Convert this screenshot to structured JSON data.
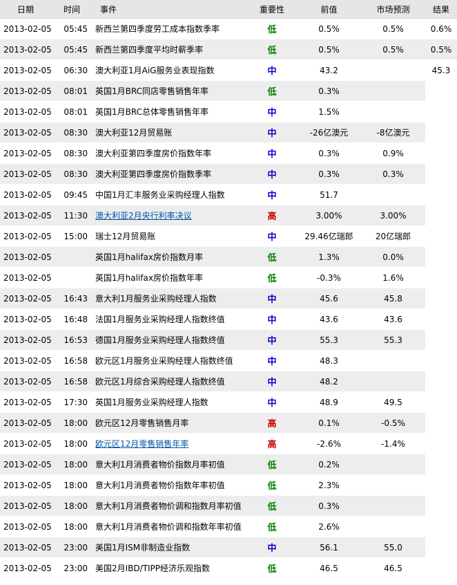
{
  "headers": {
    "date": "日期",
    "time": "时间",
    "event": "事件",
    "importance": "重要性",
    "previous": "前值",
    "forecast": "市场预测",
    "result": "结果"
  },
  "importance_colors": {
    "低": "#008000",
    "中": "#0000cc",
    "高": "#cc0000"
  },
  "rows": [
    {
      "date": "2013-02-05",
      "time": "05:45",
      "event": "新西兰第四季度劳工成本指数季率",
      "importance": "低",
      "previous": "0.5%",
      "forecast": "0.5%",
      "result": "0.6%",
      "link": false
    },
    {
      "date": "2013-02-05",
      "time": "05:45",
      "event": "新西兰第四季度平均时薪季率",
      "importance": "低",
      "previous": "0.5%",
      "forecast": "0.5%",
      "result": "0.5%",
      "link": false
    },
    {
      "date": "2013-02-05",
      "time": "06:30",
      "event": "澳大利亚1月AiG服务业表现指数",
      "importance": "中",
      "previous": "43.2",
      "forecast": "",
      "result": "45.3",
      "link": false
    },
    {
      "date": "2013-02-05",
      "time": "08:01",
      "event": "英国1月BRC同店零售销售年率",
      "importance": "低",
      "previous": "0.3%",
      "forecast": "",
      "result": "",
      "link": false
    },
    {
      "date": "2013-02-05",
      "time": "08:01",
      "event": "英国1月BRC总体零售销售年率",
      "importance": "中",
      "previous": "1.5%",
      "forecast": "",
      "result": "",
      "link": false
    },
    {
      "date": "2013-02-05",
      "time": "08:30",
      "event": "澳大利亚12月贸易账",
      "importance": "中",
      "previous": "-26亿澳元",
      "forecast": "-8亿澳元",
      "result": "",
      "link": false
    },
    {
      "date": "2013-02-05",
      "time": "08:30",
      "event": "澳大利亚第四季度房价指数年率",
      "importance": "中",
      "previous": "0.3%",
      "forecast": "0.9%",
      "result": "",
      "link": false
    },
    {
      "date": "2013-02-05",
      "time": "08:30",
      "event": "澳大利亚第四季度房价指数季率",
      "importance": "中",
      "previous": "0.3%",
      "forecast": "0.3%",
      "result": "",
      "link": false
    },
    {
      "date": "2013-02-05",
      "time": "09:45",
      "event": "中国1月汇丰服务业采购经理人指数",
      "importance": "中",
      "previous": "51.7",
      "forecast": "",
      "result": "",
      "link": false
    },
    {
      "date": "2013-02-05",
      "time": "11:30",
      "event": "澳大利亚2月央行利率决议",
      "importance": "高",
      "previous": "3.00%",
      "forecast": "3.00%",
      "result": "",
      "link": true
    },
    {
      "date": "2013-02-05",
      "time": "15:00",
      "event": "瑞士12月贸易账",
      "importance": "中",
      "previous": "29.46亿瑞郎",
      "forecast": "20亿瑞郎",
      "result": "",
      "link": false
    },
    {
      "date": "2013-02-05",
      "time": "",
      "event": "英国1月halifax房价指数月率",
      "importance": "低",
      "previous": "1.3%",
      "forecast": "0.0%",
      "result": "",
      "link": false
    },
    {
      "date": "2013-02-05",
      "time": "",
      "event": "英国1月halifax房价指数年率",
      "importance": "低",
      "previous": "-0.3%",
      "forecast": "1.6%",
      "result": "",
      "link": false
    },
    {
      "date": "2013-02-05",
      "time": "16:43",
      "event": "意大利1月服务业采购经理人指数",
      "importance": "中",
      "previous": "45.6",
      "forecast": "45.8",
      "result": "",
      "link": false
    },
    {
      "date": "2013-02-05",
      "time": "16:48",
      "event": "法国1月服务业采购经理人指数终值",
      "importance": "中",
      "previous": "43.6",
      "forecast": "43.6",
      "result": "",
      "link": false
    },
    {
      "date": "2013-02-05",
      "time": "16:53",
      "event": "德国1月服务业采购经理人指数终值",
      "importance": "中",
      "previous": "55.3",
      "forecast": "55.3",
      "result": "",
      "link": false
    },
    {
      "date": "2013-02-05",
      "time": "16:58",
      "event": "欧元区1月服务业采购经理人指数终值",
      "importance": "中",
      "previous": "48.3",
      "forecast": "",
      "result": "",
      "link": false
    },
    {
      "date": "2013-02-05",
      "time": "16:58",
      "event": "欧元区1月综合采购经理人指数终值",
      "importance": "中",
      "previous": "48.2",
      "forecast": "",
      "result": "",
      "link": false
    },
    {
      "date": "2013-02-05",
      "time": "17:30",
      "event": "英国1月服务业采购经理人指数",
      "importance": "中",
      "previous": "48.9",
      "forecast": "49.5",
      "result": "",
      "link": false
    },
    {
      "date": "2013-02-05",
      "time": "18:00",
      "event": "欧元区12月零售销售月率",
      "importance": "高",
      "previous": "0.1%",
      "forecast": "-0.5%",
      "result": "",
      "link": false
    },
    {
      "date": "2013-02-05",
      "time": "18:00",
      "event": "欧元区12月零售销售年率",
      "importance": "高",
      "previous": "-2.6%",
      "forecast": "-1.4%",
      "result": "",
      "link": true
    },
    {
      "date": "2013-02-05",
      "time": "18:00",
      "event": "意大利1月消费者物价指数月率初值",
      "importance": "低",
      "previous": "0.2%",
      "forecast": "",
      "result": "",
      "link": false
    },
    {
      "date": "2013-02-05",
      "time": "18:00",
      "event": "意大利1月消费者物价指数年率初值",
      "importance": "低",
      "previous": "2.3%",
      "forecast": "",
      "result": "",
      "link": false
    },
    {
      "date": "2013-02-05",
      "time": "18:00",
      "event": "意大利1月消费者物价调和指数月率初值",
      "importance": "低",
      "previous": "0.3%",
      "forecast": "",
      "result": "",
      "link": false
    },
    {
      "date": "2013-02-05",
      "time": "18:00",
      "event": "意大利1月消费者物价调和指数年率初值",
      "importance": "低",
      "previous": "2.6%",
      "forecast": "",
      "result": "",
      "link": false
    },
    {
      "date": "2013-02-05",
      "time": "23:00",
      "event": "美国1月ISM非制造业指数",
      "importance": "中",
      "previous": "56.1",
      "forecast": "55.0",
      "result": "",
      "link": false
    },
    {
      "date": "2013-02-05",
      "time": "23:00",
      "event": "美国2月IBD/TIPP经济乐观指数",
      "importance": "低",
      "previous": "46.5",
      "forecast": "46.5",
      "result": "",
      "link": false
    }
  ]
}
